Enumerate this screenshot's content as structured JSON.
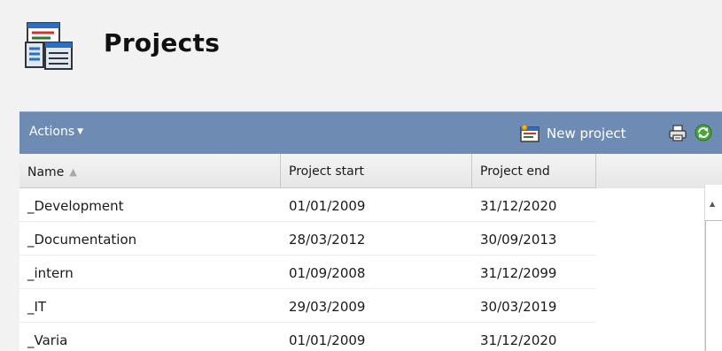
{
  "header": {
    "title": "Projects",
    "icon": "projects-list-icon"
  },
  "toolbar": {
    "actions_label": "Actions",
    "new_project_label": "New project",
    "icons": [
      "new-project-icon",
      "print-icon",
      "refresh-icon"
    ]
  },
  "grid": {
    "columns": [
      "Name",
      "Project start",
      "Project end"
    ],
    "sort": {
      "column": "Name",
      "direction": "ascending"
    },
    "rows": [
      {
        "name": "_Development",
        "start": "01/01/2009",
        "end": "31/12/2020"
      },
      {
        "name": "_Documentation",
        "start": "28/03/2012",
        "end": "30/09/2013"
      },
      {
        "name": "_intern",
        "start": "01/09/2008",
        "end": "31/12/2099"
      },
      {
        "name": "_IT",
        "start": "29/03/2009",
        "end": "30/03/2019"
      },
      {
        "name": "_Varia",
        "start": "01/01/2009",
        "end": "31/12/2020"
      }
    ]
  },
  "colors": {
    "toolbar_bg": "#6e8bb4",
    "page_bg": "#f2f2f2",
    "grid_bg": "#ffffff"
  }
}
